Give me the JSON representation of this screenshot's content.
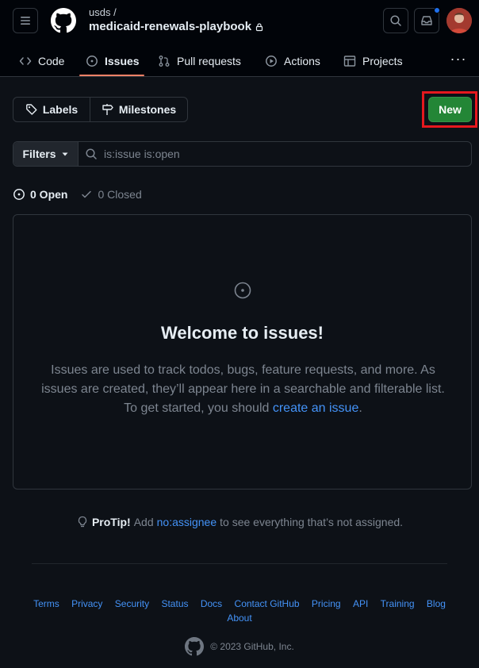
{
  "header": {
    "owner": "usds /",
    "repo": "medicaid-renewals-playbook"
  },
  "nav": {
    "tabs": [
      {
        "label": "Code",
        "icon": "code-icon"
      },
      {
        "label": "Issues",
        "icon": "issue-opened-icon",
        "active": true
      },
      {
        "label": "Pull requests",
        "icon": "git-pull-request-icon"
      },
      {
        "label": "Actions",
        "icon": "play-icon"
      },
      {
        "label": "Projects",
        "icon": "table-icon"
      }
    ],
    "more": "···"
  },
  "toolbar": {
    "labels": "Labels",
    "milestones": "Milestones",
    "new": "New"
  },
  "filter": {
    "button": "Filters",
    "query": "is:issue is:open"
  },
  "states": {
    "open": "0 Open",
    "closed": "0 Closed"
  },
  "blankslate": {
    "title": "Welcome to issues!",
    "text_before": "Issues are used to track todos, bugs, feature requests, and more. As issues are created, they’ll appear here in a searchable and filterable list. To get started, you should ",
    "link": "create an issue",
    "text_after": "."
  },
  "protip": {
    "label": "ProTip!",
    "before": "Add",
    "link": "no:assignee",
    "after": "to see everything that’s not assigned."
  },
  "footer": {
    "links": [
      "Terms",
      "Privacy",
      "Security",
      "Status",
      "Docs",
      "Contact GitHub",
      "Pricing",
      "API",
      "Training",
      "Blog",
      "About"
    ],
    "copyright": "© 2023 GitHub, Inc."
  },
  "colors": {
    "background": "#0d1117",
    "header": "#010409",
    "border": "#30363d",
    "primary_button": "#238636",
    "link": "#4493f8",
    "muted": "#7d8590",
    "active_tab_underline": "#f78166",
    "highlight_box": "#e5181e"
  }
}
